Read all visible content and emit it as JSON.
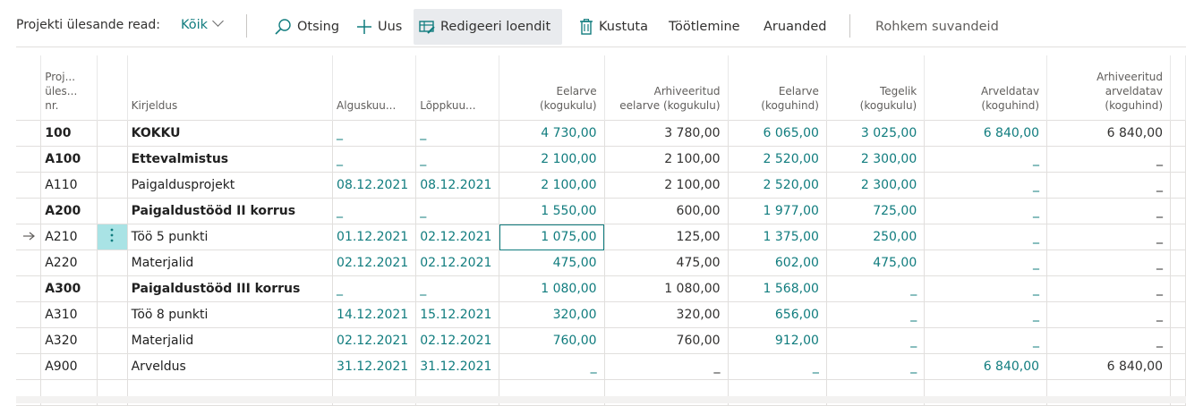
{
  "toolbar": {
    "title": "Projekti ülesande read:",
    "filter": "Kõik",
    "search": "Otsing",
    "new": "Uus",
    "edit_list": "Redigeeri loendit",
    "delete": "Kustuta",
    "processing": "Töötlemine",
    "reports": "Aruanded",
    "more": "Rohkem suvandeid"
  },
  "columns": {
    "nr_line1": "Proj...",
    "nr_line2": "üles...",
    "nr_line3": "nr.",
    "desc": "Kirjeldus",
    "start": "Alguskuu...",
    "end": "Lõppkuu...",
    "budget_cost_1": "Eelarve",
    "budget_cost_2": "(kogukulu)",
    "arch_budget_1": "Arhiveeritud",
    "arch_budget_2": "eelarve (kogukulu)",
    "budget_price_1": "Eelarve",
    "budget_price_2": "(koguhind)",
    "actual_1": "Tegelik",
    "actual_2": "(kogukulu)",
    "billable_1": "Arveldatav",
    "billable_2": "(koguhind)",
    "arch_billable_1": "Arhiveeritud",
    "arch_billable_2": "arveldatav",
    "arch_billable_3": "(koguhind)"
  },
  "rows": [
    {
      "nr": "100",
      "desc": "KOKKU",
      "start": "_",
      "end": "_",
      "budget_cost": "4 730,00",
      "arch_budget": "3 780,00",
      "budget_price": "6 065,00",
      "actual": "3 025,00",
      "billable": "6 840,00",
      "arch_billable": "6 840,00"
    },
    {
      "nr": "A100",
      "desc": "Ettevalmistus",
      "start": "_",
      "end": "_",
      "budget_cost": "2 100,00",
      "arch_budget": "2 100,00",
      "budget_price": "2 520,00",
      "actual": "2 300,00",
      "billable": "_",
      "arch_billable": "_"
    },
    {
      "nr": "A110",
      "desc": "Paigaldusprojekt",
      "start": "08.12.2021",
      "end": "08.12.2021",
      "budget_cost": "2 100,00",
      "arch_budget": "2 100,00",
      "budget_price": "2 520,00",
      "actual": "2 300,00",
      "billable": "_",
      "arch_billable": "_"
    },
    {
      "nr": "A200",
      "desc": "Paigaldustööd II korrus",
      "start": "_",
      "end": "_",
      "budget_cost": "1 550,00",
      "arch_budget": "600,00",
      "budget_price": "1 977,00",
      "actual": "725,00",
      "billable": "_",
      "arch_billable": "_"
    },
    {
      "nr": "A210",
      "desc": "Töö 5 punkti",
      "start": "01.12.2021",
      "end": "02.12.2021",
      "budget_cost": "1 075,00",
      "arch_budget": "125,00",
      "budget_price": "1 375,00",
      "actual": "250,00",
      "billable": "_",
      "arch_billable": "_"
    },
    {
      "nr": "A220",
      "desc": "Materjalid",
      "start": "02.12.2021",
      "end": "02.12.2021",
      "budget_cost": "475,00",
      "arch_budget": "475,00",
      "budget_price": "602,00",
      "actual": "475,00",
      "billable": "_",
      "arch_billable": "_"
    },
    {
      "nr": "A300",
      "desc": "Paigaldustööd III korrus",
      "start": "_",
      "end": "_",
      "budget_cost": "1 080,00",
      "arch_budget": "1 080,00",
      "budget_price": "1 568,00",
      "actual": "_",
      "billable": "_",
      "arch_billable": "_"
    },
    {
      "nr": "A310",
      "desc": "Töö 8 punkti",
      "start": "14.12.2021",
      "end": "15.12.2021",
      "budget_cost": "320,00",
      "arch_budget": "320,00",
      "budget_price": "656,00",
      "actual": "_",
      "billable": "_",
      "arch_billable": "_"
    },
    {
      "nr": "A320",
      "desc": "Materjalid",
      "start": "02.12.2021",
      "end": "02.12.2021",
      "budget_cost": "760,00",
      "arch_budget": "760,00",
      "budget_price": "912,00",
      "actual": "_",
      "billable": "_",
      "arch_billable": "_"
    },
    {
      "nr": "A900",
      "desc": "Arveldus",
      "start": "31.12.2021",
      "end": "31.12.2021",
      "budget_cost": "_",
      "arch_budget": "_",
      "budget_price": "_",
      "actual": "_",
      "billable": "6 840,00",
      "arch_billable": "6 840,00"
    }
  ],
  "icons": {
    "current_row": "arrow-right-icon",
    "row_menu": "vertical-ellipsis-icon"
  },
  "colors": {
    "accent": "#107c7e",
    "selected_cell": "#a9e3e5",
    "active_button": "#e9ebee"
  }
}
